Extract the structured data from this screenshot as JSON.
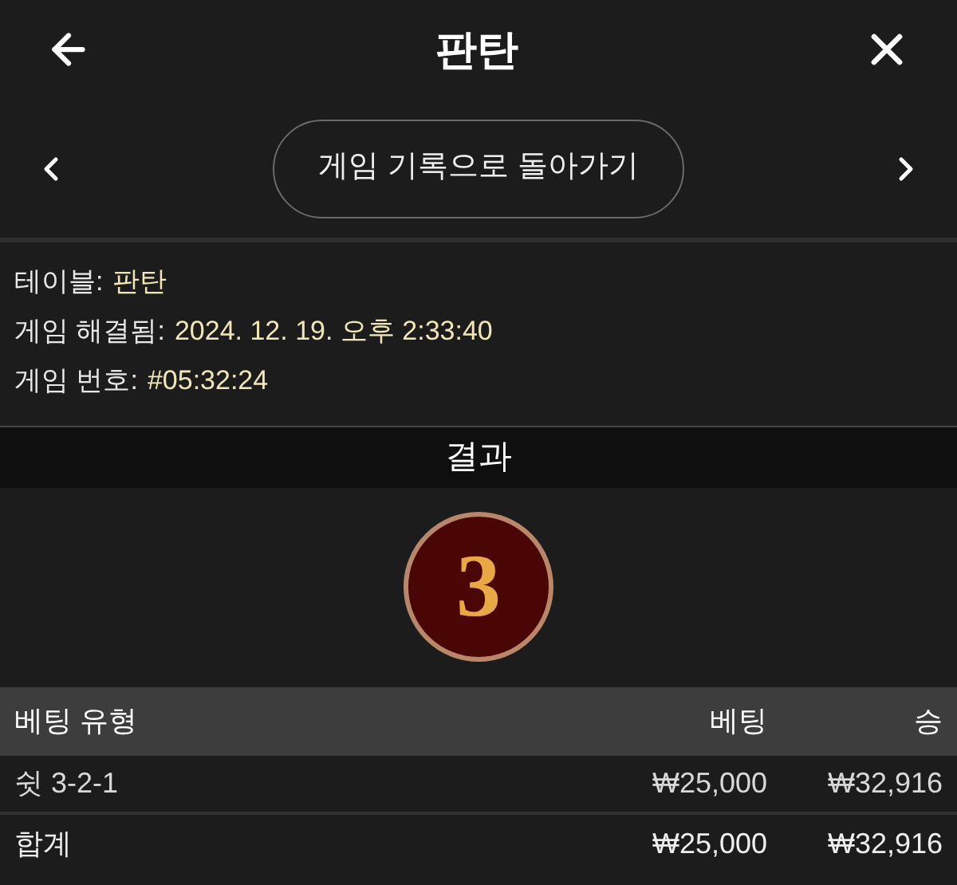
{
  "header": {
    "title": "판탄"
  },
  "navigation": {
    "back_to_history": "게임 기록으로 돌아가기"
  },
  "details": [
    {
      "label": "테이블:",
      "value": "판탄"
    },
    {
      "label": "게임 해결됨:",
      "value": "2024. 12. 19. 오후 2:33:40"
    },
    {
      "label": "게임 번호:",
      "value": "#05:32:24"
    }
  ],
  "result": {
    "title": "결과",
    "number": "3"
  },
  "table": {
    "columns": [
      "베팅 유형",
      "베팅",
      "승"
    ],
    "rows": [
      [
        "쉿 3-2-1",
        "₩25,000",
        "₩32,916"
      ]
    ],
    "total": [
      "합계",
      "₩25,000",
      "₩32,916"
    ]
  }
}
